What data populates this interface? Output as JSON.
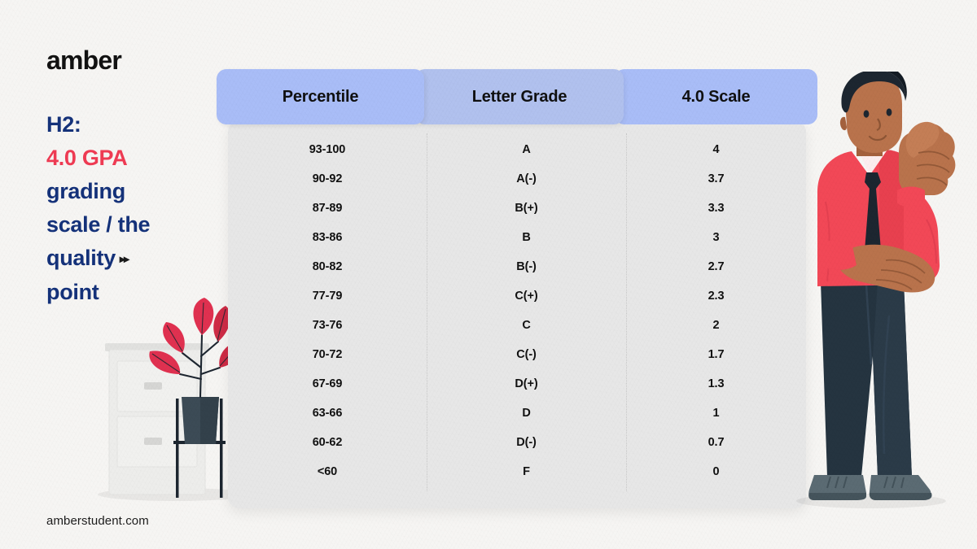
{
  "brand": {
    "logo": "amber",
    "site_url": "amberstudent.com",
    "colors": {
      "navy": "#15327a",
      "accent_red": "#ef3b53",
      "header_blue": "#a9bdf7",
      "header_blue_alt": "#b1c1ee",
      "card_gray": "#e7e7e7",
      "page_bg": "#f6f5f3"
    }
  },
  "headline": {
    "label": "H2:",
    "accent": "4.0 GPA",
    "rest_line_1": "grading",
    "rest_line_2": "scale / the",
    "rest_line_3": "quality",
    "rest_line_4": "point",
    "arrows": "▸▸"
  },
  "table": {
    "columns": [
      {
        "label": "Percentile",
        "key": "percentile"
      },
      {
        "label": "Letter Grade",
        "key": "letter_grade"
      },
      {
        "label": "4.0 Scale",
        "key": "scale"
      }
    ],
    "rows": [
      {
        "percentile": "93-100",
        "letter_grade": "A",
        "scale": "4"
      },
      {
        "percentile": "90-92",
        "letter_grade": "A(-)",
        "scale": "3.7"
      },
      {
        "percentile": "87-89",
        "letter_grade": "B(+)",
        "scale": "3.3"
      },
      {
        "percentile": "83-86",
        "letter_grade": "B",
        "scale": "3"
      },
      {
        "percentile": "80-82",
        "letter_grade": "B(-)",
        "scale": "2.7"
      },
      {
        "percentile": "77-79",
        "letter_grade": "C(+)",
        "scale": "2.3"
      },
      {
        "percentile": "73-76",
        "letter_grade": "C",
        "scale": "2"
      },
      {
        "percentile": "70-72",
        "letter_grade": "C(-)",
        "scale": "1.7"
      },
      {
        "percentile": "67-69",
        "letter_grade": "D(+)",
        "scale": "1.3"
      },
      {
        "percentile": "63-66",
        "letter_grade": "D",
        "scale": "1"
      },
      {
        "percentile": "60-62",
        "letter_grade": "D(-)",
        "scale": "0.7"
      },
      {
        "percentile": "<60",
        "letter_grade": "F",
        "scale": "0"
      }
    ]
  },
  "illustration": {
    "character": "man-thumbs-up-illustration",
    "character_colors": {
      "shirt": "#f24857",
      "shirt_shade": "#d93b4b",
      "skin": "#b9734c",
      "skin_shade": "#a4613d",
      "hair": "#1d2630",
      "tie": "#1d2630",
      "pants": "#253440",
      "shoes": "#5b6b73"
    },
    "plant": "red-leaf-plant",
    "plant_colors": {
      "leaf": "#e03150",
      "leaf_dark": "#c2283f",
      "pot": "#3c4b56",
      "stem": "#1d2630"
    },
    "cabinet": "filing-cabinet",
    "cabinet_colors": {
      "body": "#ececea",
      "edge": "#dedede",
      "handle": "#d4d4d4"
    }
  }
}
